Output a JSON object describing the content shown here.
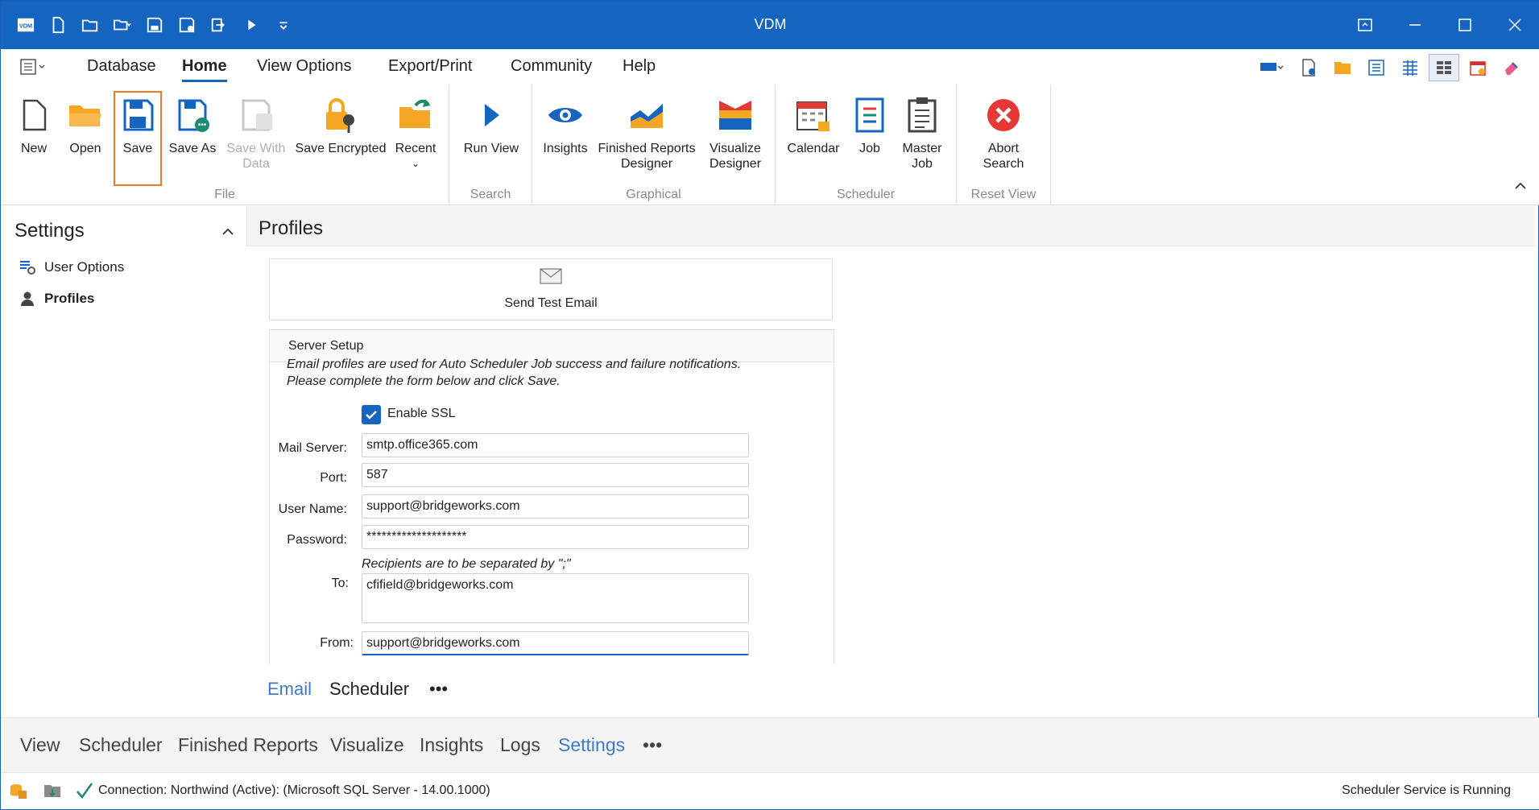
{
  "window": {
    "title": "VDM",
    "logo_text": "VDM"
  },
  "menu": {
    "tabs": [
      "Database",
      "Home",
      "View Options",
      "Export/Print",
      "Community",
      "Help"
    ],
    "active": "Home"
  },
  "ribbon": {
    "file": {
      "caption": "File",
      "buttons": {
        "new": "New",
        "open": "Open",
        "save": "Save",
        "save_as": "Save As",
        "save_with_data": "Save With Data",
        "save_encrypted": "Save Encrypted",
        "recent": "Recent"
      }
    },
    "search": {
      "caption": "Search",
      "run_view": "Run View"
    },
    "graphical": {
      "caption": "Graphical",
      "insights": "Insights",
      "finished_reports_designer": "Finished Reports Designer",
      "visualize_designer": "Visualize Designer"
    },
    "scheduler": {
      "caption": "Scheduler",
      "calendar": "Calendar",
      "job": "Job",
      "master_job": "Master Job"
    },
    "reset_view": {
      "caption": "Reset View",
      "abort_search": "Abort Search"
    }
  },
  "sidebar": {
    "title": "Settings",
    "items": [
      "User Options",
      "Profiles"
    ],
    "selected": "Profiles"
  },
  "content": {
    "title": "Profiles",
    "send_test_email": "Send Test Email",
    "server_setup": {
      "title": "Server Setup",
      "note_line1": "Email profiles are used for Auto Scheduler Job success and failure notifications.",
      "note_line2": "Please complete the form below and click Save.",
      "enable_ssl_label": "Enable SSL",
      "enable_ssl_checked": true,
      "fields": {
        "mail_server": {
          "label": "Mail Server:",
          "value": "smtp.office365.com"
        },
        "port": {
          "label": "Port:",
          "value": "587"
        },
        "user_name": {
          "label": "User Name:",
          "value": "support@bridgeworks.com"
        },
        "password": {
          "label": "Password:",
          "value": "********************"
        },
        "recipients_note": "Recipients are to be separated by \";\"",
        "to": {
          "label": "To:",
          "value": "cfifield@bridgeworks.com"
        },
        "from": {
          "label": "From:",
          "value": "support@bridgeworks.com"
        }
      }
    },
    "inner_tabs": [
      "Email",
      "Scheduler",
      "•••"
    ],
    "inner_active": "Email"
  },
  "bottom_tabs": [
    "View",
    "Scheduler",
    "Finished Reports",
    "Visualize",
    "Insights",
    "Logs",
    "Settings",
    "•••"
  ],
  "bottom_active": "Settings",
  "status": {
    "connection": "Connection: Northwind (Active): (Microsoft SQL Server - 14.00.1000)",
    "service": "Scheduler Service is Running"
  },
  "colors": {
    "accent": "#1565c0",
    "highlight": "#f07a2a",
    "orange_icon": "#f5a623",
    "active_tab": "#3f7bc8"
  }
}
